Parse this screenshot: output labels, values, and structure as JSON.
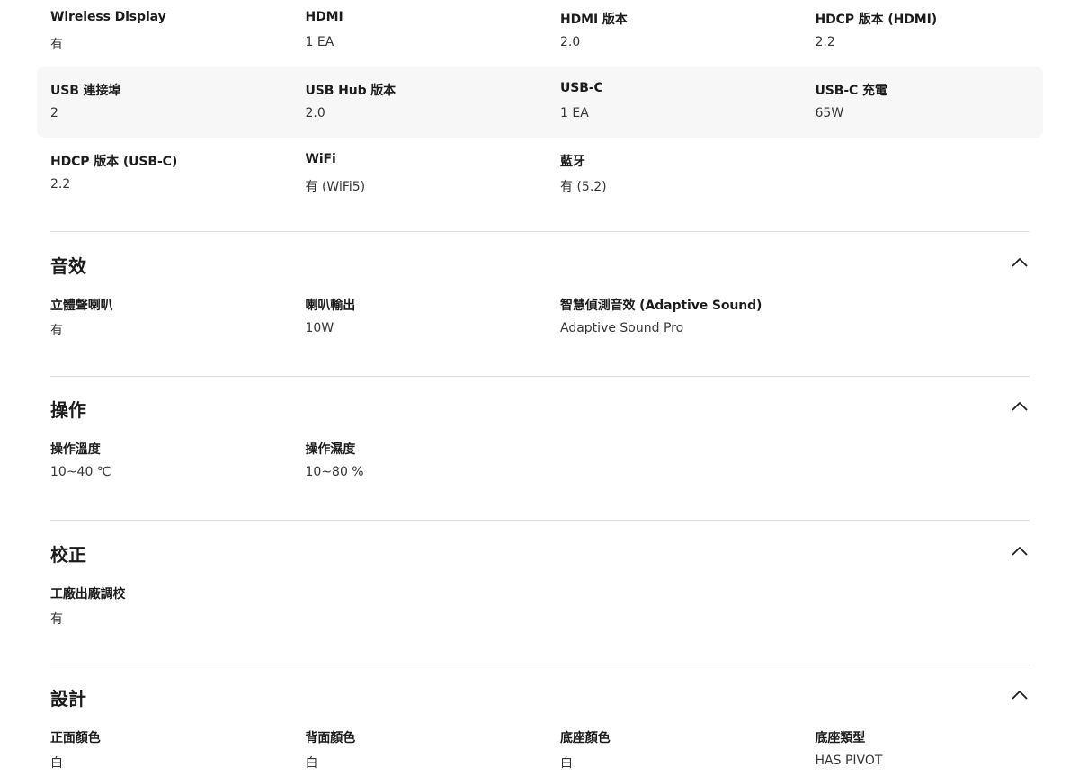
{
  "connectivity": {
    "rows": [
      [
        {
          "label": "Wireless Display",
          "value": "有"
        },
        {
          "label": "HDMI",
          "value": "1 EA"
        },
        {
          "label": "HDMI 版本",
          "value": "2.0"
        },
        {
          "label": "HDCP 版本 (HDMI)",
          "value": "2.2"
        }
      ],
      [
        {
          "label": "USB 連接埠",
          "value": "2"
        },
        {
          "label": "USB Hub 版本",
          "value": "2.0"
        },
        {
          "label": "USB-C",
          "value": "1 EA"
        },
        {
          "label": "USB-C 充電",
          "value": "65W"
        }
      ],
      [
        {
          "label": "HDCP 版本 (USB-C)",
          "value": "2.2"
        },
        {
          "label": "WiFi",
          "value": "有 (WiFi5)"
        },
        {
          "label": "藍牙",
          "value": "有 (5.2)"
        }
      ]
    ]
  },
  "sections": [
    {
      "title": "音效",
      "icon": "chevron-up-icon",
      "rows": [
        [
          {
            "label": "立體聲喇叭",
            "value": "有"
          },
          {
            "label": "喇叭輸出",
            "value": "10W"
          },
          {
            "label": "智慧偵測音效 (Adaptive Sound)",
            "value": "Adaptive Sound Pro"
          }
        ]
      ]
    },
    {
      "title": "操作",
      "icon": "chevron-up-icon",
      "rows": [
        [
          {
            "label": "操作溫度",
            "value": "10~40 ℃"
          },
          {
            "label": "操作濕度",
            "value": "10~80 %"
          }
        ]
      ]
    },
    {
      "title": "校正",
      "icon": "chevron-up-icon",
      "rows": [
        [
          {
            "label": "工廠出廠調校",
            "value": "有"
          }
        ]
      ]
    },
    {
      "title": "設計",
      "icon": "chevron-up-icon",
      "rows": [
        [
          {
            "label": "正面顏色",
            "value": "白"
          },
          {
            "label": "背面顏色",
            "value": "白"
          },
          {
            "label": "底座顏色",
            "value": "白"
          },
          {
            "label": "底座類型",
            "value": "HAS PIVOT"
          }
        ]
      ]
    }
  ],
  "colors": {
    "shaded_row": "#f7f7f7",
    "divider": "#dddddd",
    "text": "#1c1c1c"
  }
}
